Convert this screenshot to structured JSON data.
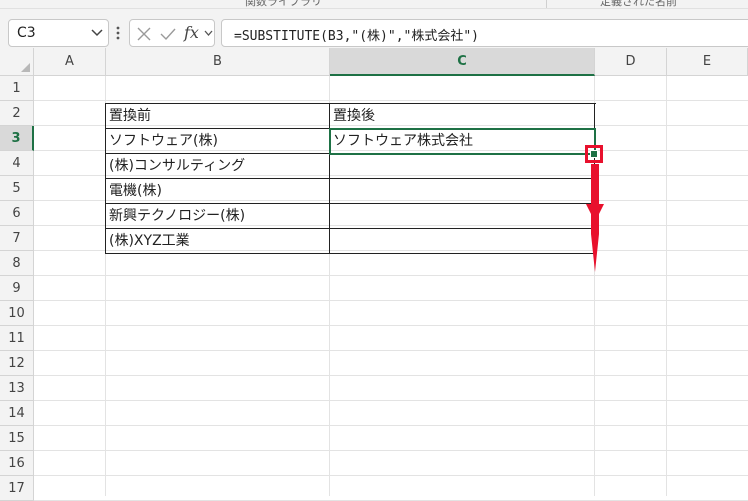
{
  "ribbon": {
    "group_1": "関数ライブラリ",
    "group_2": "定義された名前"
  },
  "name_box": {
    "value": "C3"
  },
  "formula_bar": {
    "fx_label": "fx",
    "formula": "=SUBSTITUTE(B3,\"(株)\",\"株式会社\")"
  },
  "columns": [
    "A",
    "B",
    "C",
    "D",
    "E"
  ],
  "selected_column": "C",
  "rows": [
    "1",
    "2",
    "3",
    "4",
    "5",
    "6",
    "7",
    "8",
    "9",
    "10",
    "11",
    "12",
    "13",
    "14",
    "15",
    "16",
    "17"
  ],
  "selected_row": "3",
  "table": {
    "header_before": "置換前",
    "header_after": "置換後",
    "rows": [
      {
        "before": "ソフトウェア(株)",
        "after": "ソフトウェア株式会社"
      },
      {
        "before": "(株)コンサルティング",
        "after": ""
      },
      {
        "before": "電機(株)",
        "after": ""
      },
      {
        "before": "新興テクノロジー(株)",
        "after": ""
      },
      {
        "before": "(株)XYZ工業",
        "after": ""
      }
    ]
  },
  "annotation": {
    "highlight_color": "#e8112d",
    "meaning": "fill handle drag down"
  },
  "colors": {
    "accent": "#1e7145",
    "annotation": "#e8112d"
  }
}
